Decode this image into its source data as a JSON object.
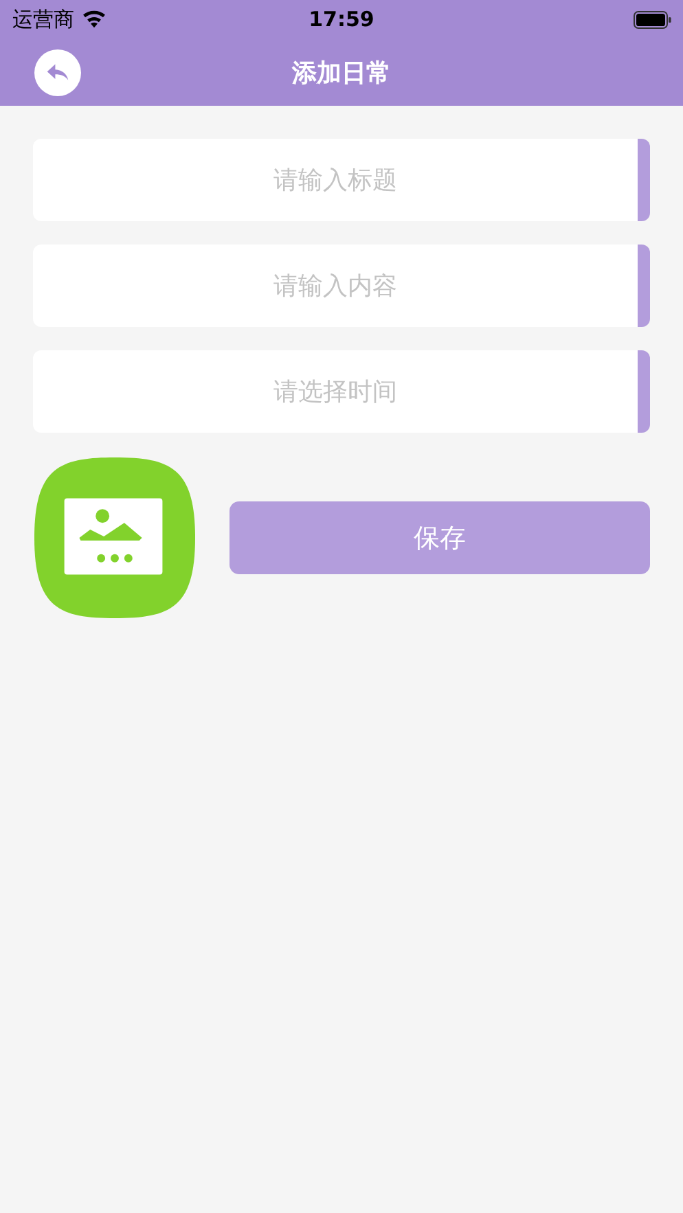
{
  "status_bar": {
    "carrier": "运营商",
    "time": "17:59"
  },
  "nav_bar": {
    "title": "添加日常"
  },
  "fields": [
    {
      "placeholder": "请输入标题"
    },
    {
      "placeholder": "请输入内容"
    },
    {
      "placeholder": "请选择时间"
    }
  ],
  "save_button": {
    "label": "保存"
  }
}
